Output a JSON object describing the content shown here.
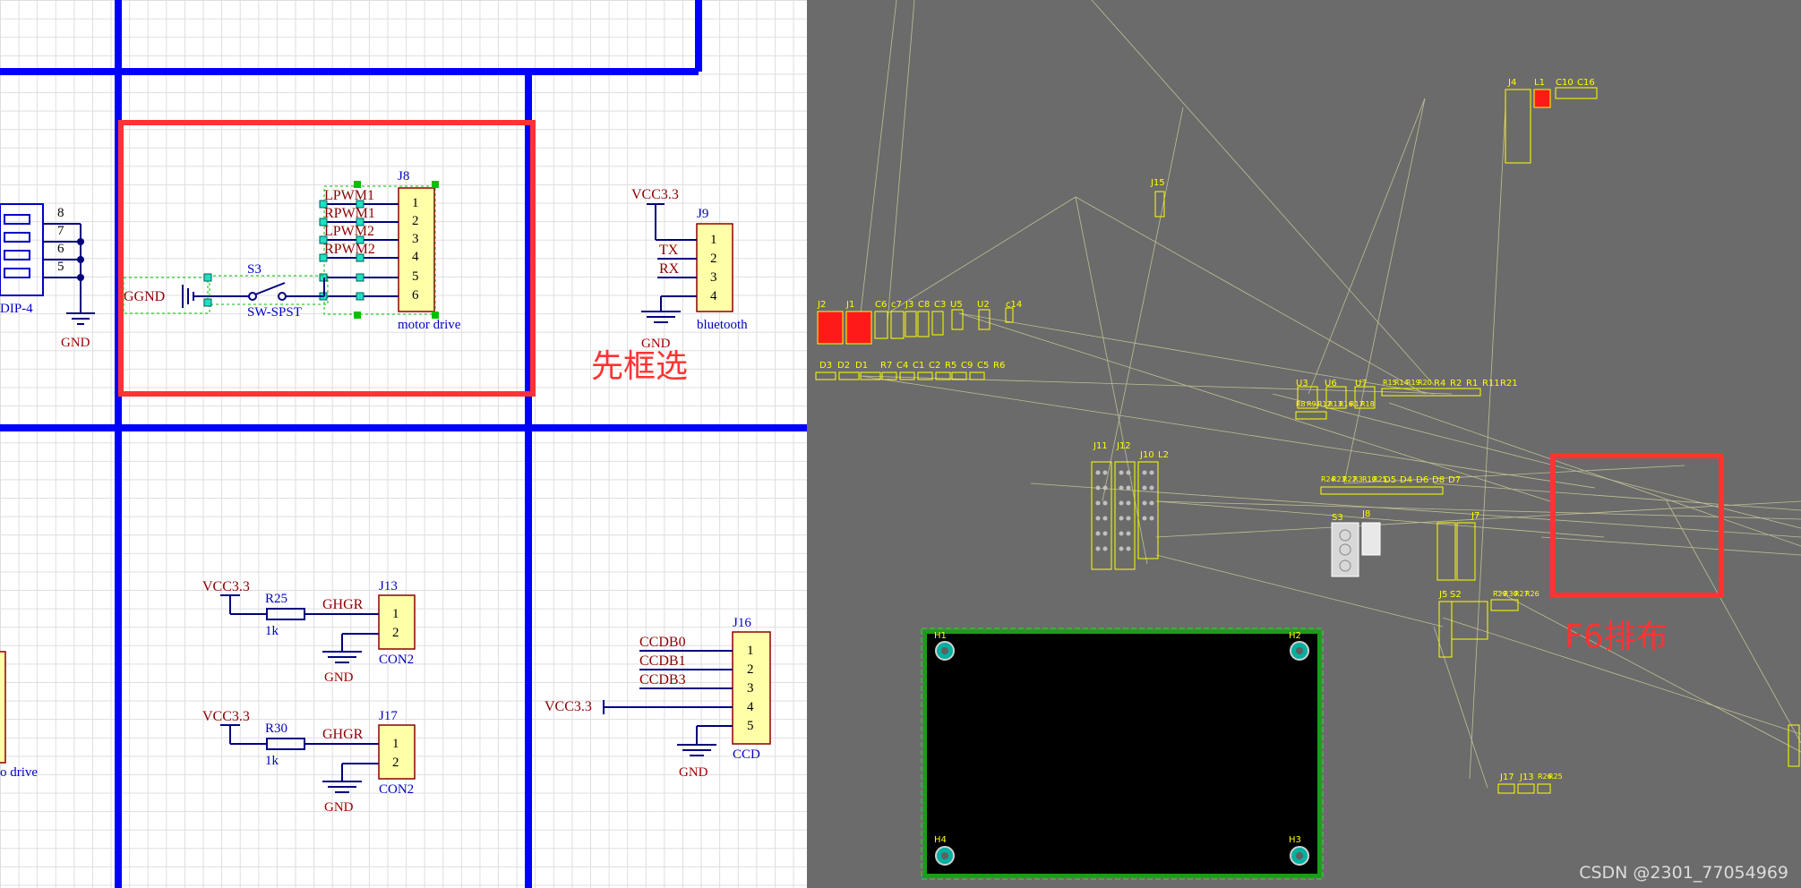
{
  "colors": {
    "sheet_border": "#0000ff",
    "highlight": "#ff3333",
    "component_fill": "#ffffa8",
    "pcb_background": "#6b6b6b",
    "pcb_label": "#ffff00",
    "net_label": "#a00000",
    "designator": "#0000c8"
  },
  "schematic": {
    "partial_part": {
      "pins": [
        "8",
        "7",
        "6",
        "5"
      ],
      "name": "DIP-4",
      "gnd": "GND"
    },
    "j8": {
      "designator": "J8",
      "nets": [
        "LPWM1",
        "RPWM1",
        "LPWM2",
        "RPWM2"
      ],
      "pins": [
        "1",
        "2",
        "3",
        "4",
        "5",
        "6"
      ],
      "comment": "motor drive"
    },
    "s3": {
      "designator": "S3",
      "comment": "SW-SPST",
      "gnd_net": "GGND"
    },
    "j9": {
      "designator": "J9",
      "power": "VCC3.3",
      "nets": [
        "TX",
        "RX"
      ],
      "pins": [
        "1",
        "2",
        "3",
        "4"
      ],
      "comment": "bluetooth",
      "gnd": "GND"
    },
    "annotation_select": "先框选",
    "j13": {
      "designator": "J13",
      "power": "VCC3.3",
      "resistor": "R25",
      "resistor_value": "1k",
      "net": "GHGR",
      "pins": [
        "1",
        "2"
      ],
      "comment": "CON2",
      "gnd": "GND"
    },
    "j17": {
      "designator": "J17",
      "power": "VCC3.3",
      "resistor": "R30",
      "resistor_value": "1k",
      "net": "GHGR",
      "pins": [
        "1",
        "2"
      ],
      "comment": "CON2",
      "gnd": "GND"
    },
    "j16": {
      "designator": "J16",
      "nets": [
        "CCDB0",
        "CCDB1",
        "CCDB3"
      ],
      "power": "VCC3.3",
      "pins": [
        "1",
        "2",
        "3",
        "4",
        "5"
      ],
      "comment": "CCD",
      "gnd": "GND"
    },
    "partial_drive": "o drive"
  },
  "pcb": {
    "labels_top_right": [
      "J4",
      "L1",
      "C10",
      "C16"
    ],
    "label_j15": "J15",
    "row1": [
      "J2",
      "J1",
      "C6",
      "c7",
      "J3",
      "C8",
      "C3",
      "U5",
      "U2",
      "c14"
    ],
    "row2": [
      "D3",
      "D2",
      "D1",
      "R7",
      "C4",
      "C1",
      "C2",
      "R5",
      "C9",
      "C5",
      "R6"
    ],
    "row3": [
      "U3",
      "U6",
      "U7",
      "R15",
      "R14",
      "R19",
      "R20",
      "R4",
      "R2",
      "R1",
      "R11",
      "R21"
    ],
    "row3b": [
      "R8",
      "R9",
      "R12",
      "R13",
      "R16",
      "R17",
      "R18"
    ],
    "row4": [
      "J11",
      "J12",
      "J10",
      "L2"
    ],
    "row5": [
      "R24",
      "R23",
      "R22",
      "R3",
      "R10",
      "R25",
      "D5",
      "D4",
      "D6",
      "D8",
      "D7"
    ],
    "selected": [
      "S3",
      "J8"
    ],
    "right_edge": [
      "J7"
    ],
    "mid": [
      "J5",
      "S2",
      "R29",
      "R30",
      "R27",
      "R26"
    ],
    "bottom": [
      "J17",
      "J13",
      "R26",
      "R25"
    ],
    "holes": [
      "H1",
      "H2",
      "H4",
      "H3"
    ],
    "annotation_arrange": "F6排布"
  },
  "watermark": "CSDN @2301_77054969"
}
